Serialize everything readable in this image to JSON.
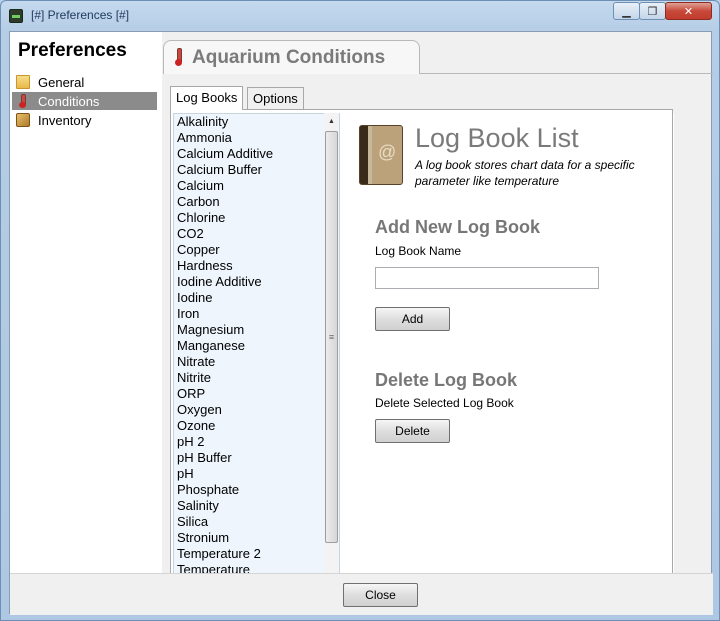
{
  "window": {
    "title": "[#] Preferences [#]",
    "minimize_label": "▁",
    "maximize_label": "❐",
    "close_label": "✕"
  },
  "sidebar": {
    "heading": "Preferences",
    "items": [
      {
        "label": "General",
        "icon": "folder-icon",
        "selected": false
      },
      {
        "label": "Conditions",
        "icon": "thermometer-icon",
        "selected": true
      },
      {
        "label": "Inventory",
        "icon": "box-icon",
        "selected": false
      }
    ]
  },
  "main": {
    "header_title": "Aquarium Conditions",
    "tabs": [
      {
        "label": "Log Books",
        "active": true
      },
      {
        "label": "Options",
        "active": false
      }
    ],
    "logbook_list": [
      "Alkalinity",
      "Ammonia",
      "Calcium Additive",
      "Calcium Buffer",
      "Calcium",
      "Carbon",
      "Chlorine",
      "CO2",
      "Copper",
      "Hardness",
      "Iodine Additive",
      "Iodine",
      "Iron",
      "Magnesium",
      "Manganese",
      "Nitrate",
      "Nitrite",
      "ORP",
      "Oxygen",
      "Ozone",
      "pH 2",
      "pH Buffer",
      "pH",
      "Phosphate",
      "Salinity",
      "Silica",
      "Stronium",
      "Temperature 2",
      "Temperature"
    ],
    "info": {
      "title": "Log Book List",
      "description": "A log book stores chart data for a specific parameter like temperature",
      "add_heading": "Add New Log Book",
      "name_label": "Log Book Name",
      "name_value": "",
      "add_button": "Add",
      "delete_heading": "Delete Log Book",
      "delete_label": "Delete Selected Log Book",
      "delete_button": "Delete"
    }
  },
  "footer": {
    "close_button": "Close"
  },
  "colors": {
    "selected_bg": "#8b8b8b",
    "list_bg": "#eef5fd",
    "heading_gray": "#777777"
  }
}
